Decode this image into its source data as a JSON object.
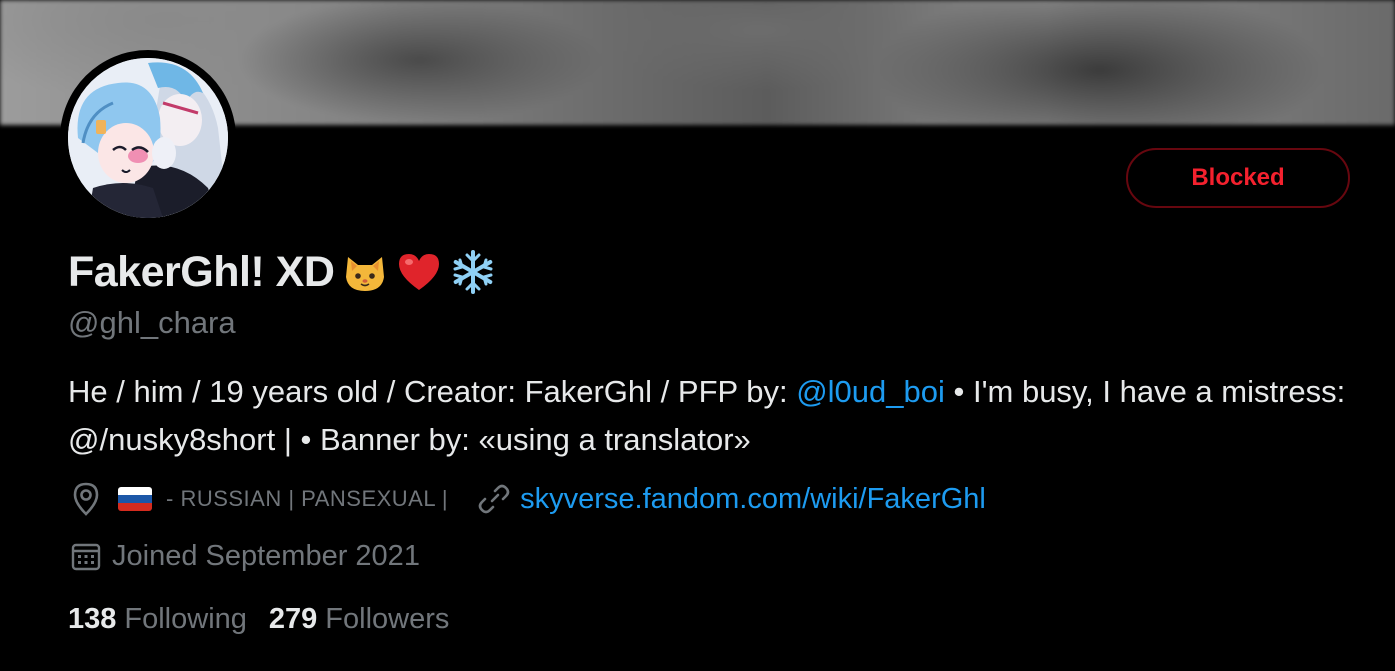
{
  "profile": {
    "display_name": "FakerGhl! XD",
    "name_emojis": [
      "cat-face-emoji",
      "red-heart-emoji",
      "snowflake-emoji"
    ],
    "handle": "@ghl_chara",
    "action_button": "Blocked",
    "bio": {
      "part1": "He / him / 19 years old / Creator: FakerGhl / PFP by: ",
      "mention": "@l0ud_boi",
      "part2": " • I'm busy, I have a mistress: @/nusky8short | • Banner by: «using a translator»"
    },
    "location": "- RUSSIAN | PANSEXUAL |",
    "location_flag": "russia-flag",
    "website": "skyverse.fandom.com/wiki/FakerGhl",
    "joined": "Joined September 2021",
    "following_count": "138",
    "following_label": "Following",
    "followers_count": "279",
    "followers_label": "Followers"
  },
  "colors": {
    "background": "#000000",
    "text_primary": "#e7e9ea",
    "text_secondary": "#71767b",
    "link": "#1d9bf0",
    "blocked_red": "#f4212e",
    "blocked_border": "#67070f"
  }
}
